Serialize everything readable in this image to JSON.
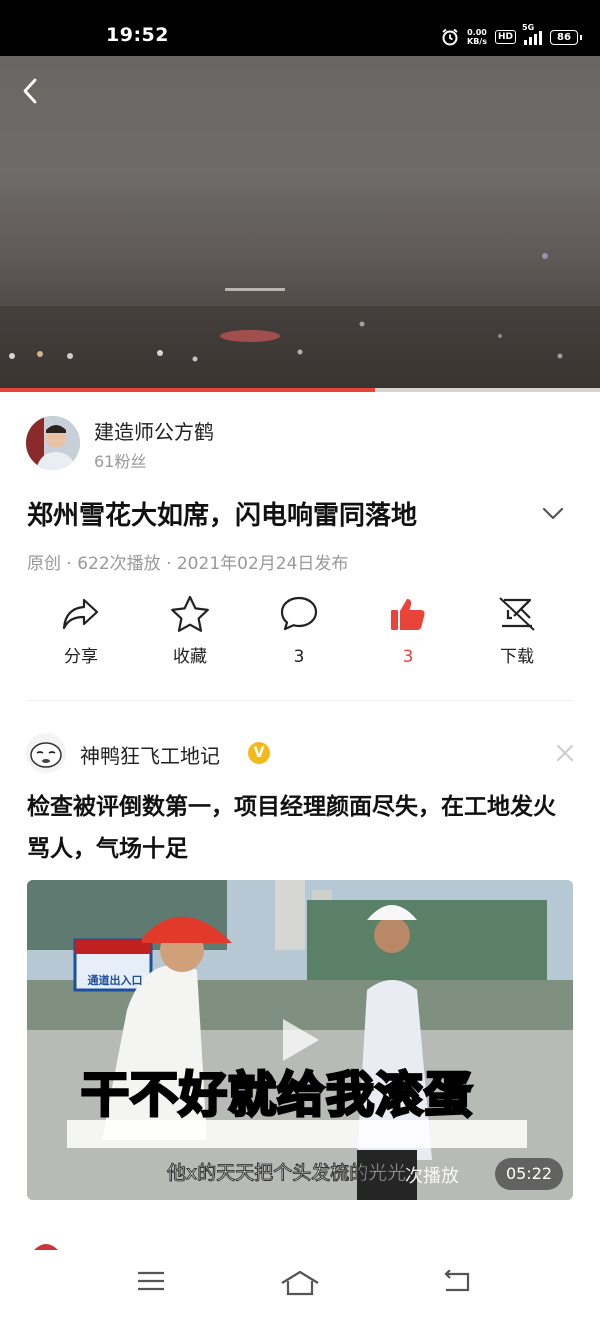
{
  "status_bar": {
    "time": "19:52",
    "net_speed_value": "0.00",
    "net_speed_unit": "KB/s",
    "hd_label": "HD",
    "network": "5G",
    "battery": "86"
  },
  "video": {
    "progress": 0.625
  },
  "author": {
    "name": "建造师公方鹤",
    "fans": "61粉丝"
  },
  "post": {
    "title": "郑州雪花大如席，闪电响雷同落地",
    "meta": "原创 · 622次播放 · 2021年02月24日发布"
  },
  "actions": {
    "share": "分享",
    "favorite": "收藏",
    "comments": "3",
    "likes": "3",
    "download": "下载"
  },
  "recommendation": {
    "author_name": "神鸭狂飞工地记",
    "verified_badge": "V",
    "title": "检查被评倒数第一，项目经理颜面尽失，在工地发火骂人，气场十足",
    "overlay_text": "干不好就给我滚蛋",
    "subtitle": "他x的天天把个头发梳的光光",
    "play_count_partial": "次播放",
    "duration": "05:22",
    "sign_text": "通道出入口"
  },
  "colors": {
    "accent_red": "#e8443a",
    "verified_yellow": "#f5b81b"
  }
}
